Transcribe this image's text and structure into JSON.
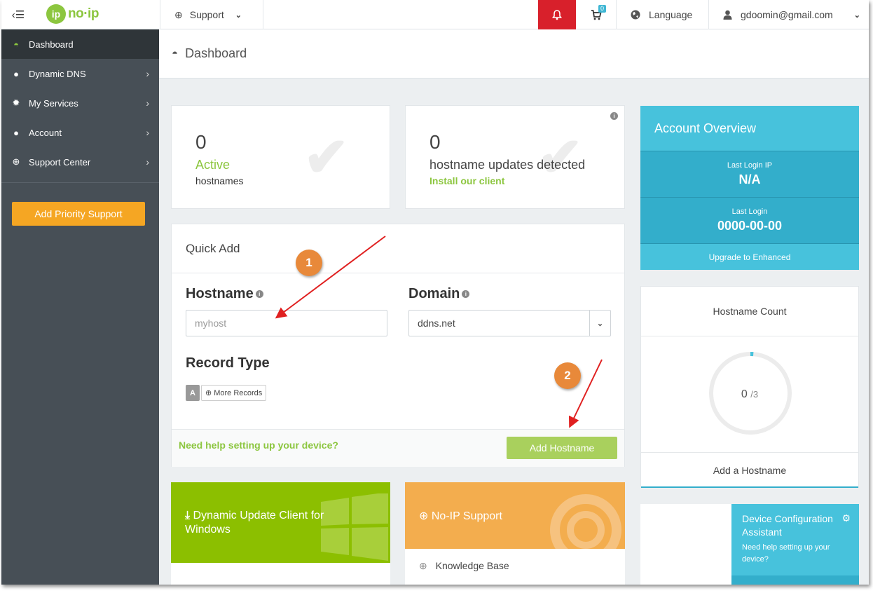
{
  "topnav": {
    "logo_text": "no·ip",
    "support_label": "Support",
    "cart_count": "0",
    "language_label": "Language",
    "user_email": "gdoomin@gmail.com"
  },
  "sidebar": {
    "items": [
      {
        "label": "Dashboard",
        "icon": "dashboard-icon"
      },
      {
        "label": "Dynamic DNS",
        "icon": "globe-icon"
      },
      {
        "label": "My Services",
        "icon": "gear-icon"
      },
      {
        "label": "Account",
        "icon": "user-icon"
      },
      {
        "label": "Support Center",
        "icon": "lifebuoy-icon"
      }
    ],
    "priority_button": "Add Priority Support"
  },
  "page": {
    "title": "Dashboard"
  },
  "stats": {
    "active": {
      "count": "0",
      "label": "Active",
      "sublabel": "hostnames"
    },
    "updates": {
      "count": "0",
      "label": "hostname updates detected",
      "link": "Install our client"
    }
  },
  "quick_add": {
    "title": "Quick Add",
    "hostname_label": "Hostname",
    "hostname_placeholder": "myhost",
    "domain_label": "Domain",
    "domain_value": "ddns.net",
    "record_type_label": "Record Type",
    "record_a": "A",
    "more_records": "More Records",
    "help_link": "Need help setting up your device?",
    "add_button": "Add Hostname"
  },
  "annotations": {
    "step1": "1",
    "step2": "2"
  },
  "account_overview": {
    "title": "Account Overview",
    "last_login_ip_label": "Last Login IP",
    "last_login_ip": "N/A",
    "last_login_label": "Last Login",
    "last_login": "0000-00-00",
    "upgrade_link": "Upgrade to Enhanced"
  },
  "hostname_count": {
    "title": "Hostname Count",
    "used": "0",
    "total": "/3",
    "fraction_used": 0.0,
    "add_link": "Add a Hostname"
  },
  "promo_cards": {
    "duc": "Dynamic Update Client for Windows",
    "support": "No-IP Support",
    "knowledge_base": "Knowledge Base"
  },
  "device_assistant": {
    "title": "Device Configuration Assistant",
    "text": "Need help setting up your device?"
  },
  "colors": {
    "brand_green": "#8cc63f",
    "sidebar_bg": "#474f56",
    "alert_red": "#d8202b",
    "accent_blue": "#47c2dc",
    "priority_orange": "#f5a623",
    "callout_orange": "#e8893a"
  }
}
